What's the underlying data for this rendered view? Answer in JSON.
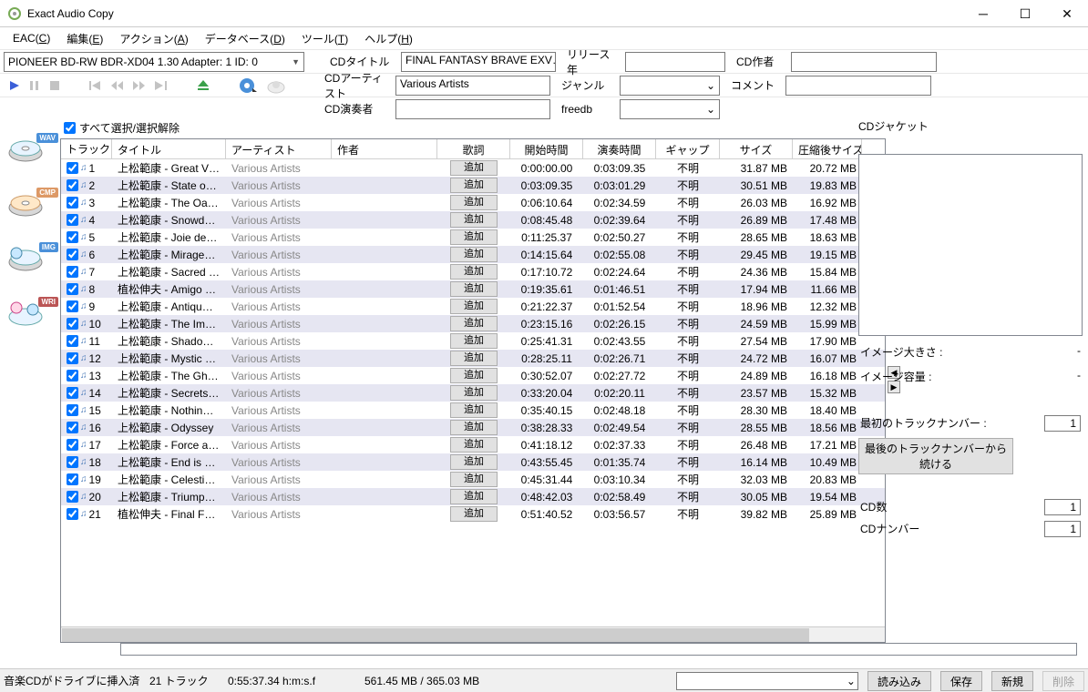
{
  "window": {
    "title": "Exact Audio Copy"
  },
  "menu": [
    "EAC(C)",
    "編集(E)",
    "アクション(A)",
    "データベース(D)",
    "ツール(T)",
    "ヘルプ(H)"
  ],
  "drive": "PIONEER BD-RW   BDR-XD04 1.30   Adapter: 1  ID: 0",
  "fields": {
    "cd_title_lbl": "CDタイトル",
    "cd_title": "FINAL FANTASY BRAVE EXV…",
    "cd_artist_lbl": "CDアーティスト",
    "cd_artist": "Various Artists",
    "cd_perf_lbl": "CD演奏者",
    "cd_perf": "",
    "release_lbl": "リリース年",
    "release": "",
    "genre_lbl": "ジャンル",
    "genre": "",
    "freedb_lbl": "freedb",
    "freedb": "",
    "cd_author_lbl": "CD作者",
    "cd_author": "",
    "comment_lbl": "コメント",
    "comment": ""
  },
  "selall": "すべて選択/選択解除",
  "cols": {
    "track": "トラック",
    "title": "タイトル",
    "artist": "アーティスト",
    "comp": "作者",
    "lyr": "歌詞",
    "start": "開始時間",
    "play": "演奏時間",
    "gap": "ギャップ",
    "size": "サイズ",
    "csize": "圧縮後サイズ"
  },
  "addlabel": "追加",
  "gap_unknown": "不明",
  "tracks": [
    {
      "n": 1,
      "title": "上松範康 - Great V…",
      "artist": "Various Artists",
      "start": "0:00:00.00",
      "play": "0:03:09.35",
      "size": "31.87 MB",
      "csize": "20.72 MB"
    },
    {
      "n": 2,
      "title": "上松範康 - State o…",
      "artist": "Various Artists",
      "start": "0:03:09.35",
      "play": "0:03:01.29",
      "size": "30.51 MB",
      "csize": "19.83 MB"
    },
    {
      "n": 3,
      "title": "上松範康 - The Oa…",
      "artist": "Various Artists",
      "start": "0:06:10.64",
      "play": "0:02:34.59",
      "size": "26.03 MB",
      "csize": "16.92 MB"
    },
    {
      "n": 4,
      "title": "上松範康 - Snowd…",
      "artist": "Various Artists",
      "start": "0:08:45.48",
      "play": "0:02:39.64",
      "size": "26.89 MB",
      "csize": "17.48 MB"
    },
    {
      "n": 5,
      "title": "上松範康 - Joie de…",
      "artist": "Various Artists",
      "start": "0:11:25.37",
      "play": "0:02:50.27",
      "size": "28.65 MB",
      "csize": "18.63 MB"
    },
    {
      "n": 6,
      "title": "上松範康 - Mirage…",
      "artist": "Various Artists",
      "start": "0:14:15.64",
      "play": "0:02:55.08",
      "size": "29.45 MB",
      "csize": "19.15 MB"
    },
    {
      "n": 7,
      "title": "上松範康 - Sacred …",
      "artist": "Various Artists",
      "start": "0:17:10.72",
      "play": "0:02:24.64",
      "size": "24.36 MB",
      "csize": "15.84 MB"
    },
    {
      "n": 8,
      "title": "植松伸夫 - Amigo …",
      "artist": "Various Artists",
      "start": "0:19:35.61",
      "play": "0:01:46.51",
      "size": "17.94 MB",
      "csize": "11.66 MB"
    },
    {
      "n": 9,
      "title": "上松範康 - Antiqu…",
      "artist": "Various Artists",
      "start": "0:21:22.37",
      "play": "0:01:52.54",
      "size": "18.96 MB",
      "csize": "12.32 MB"
    },
    {
      "n": 10,
      "title": "上松範康 - The Im…",
      "artist": "Various Artists",
      "start": "0:23:15.16",
      "play": "0:02:26.15",
      "size": "24.59 MB",
      "csize": "15.99 MB"
    },
    {
      "n": 11,
      "title": "上松範康 - Shado…",
      "artist": "Various Artists",
      "start": "0:25:41.31",
      "play": "0:02:43.55",
      "size": "27.54 MB",
      "csize": "17.90 MB"
    },
    {
      "n": 12,
      "title": "上松範康 - Mystic …",
      "artist": "Various Artists",
      "start": "0:28:25.11",
      "play": "0:02:26.71",
      "size": "24.72 MB",
      "csize": "16.07 MB"
    },
    {
      "n": 13,
      "title": "上松範康 - The Gh…",
      "artist": "Various Artists",
      "start": "0:30:52.07",
      "play": "0:02:27.72",
      "size": "24.89 MB",
      "csize": "16.18 MB"
    },
    {
      "n": 14,
      "title": "上松範康 - Secrets…",
      "artist": "Various Artists",
      "start": "0:33:20.04",
      "play": "0:02:20.11",
      "size": "23.57 MB",
      "csize": "15.32 MB"
    },
    {
      "n": 15,
      "title": "上松範康 - Nothin…",
      "artist": "Various Artists",
      "start": "0:35:40.15",
      "play": "0:02:48.18",
      "size": "28.30 MB",
      "csize": "18.40 MB"
    },
    {
      "n": 16,
      "title": "上松範康 - Odyssey",
      "artist": "Various Artists",
      "start": "0:38:28.33",
      "play": "0:02:49.54",
      "size": "28.55 MB",
      "csize": "18.56 MB"
    },
    {
      "n": 17,
      "title": "上松範康 - Force a…",
      "artist": "Various Artists",
      "start": "0:41:18.12",
      "play": "0:02:37.33",
      "size": "26.48 MB",
      "csize": "17.21 MB"
    },
    {
      "n": 18,
      "title": "上松範康 - End is …",
      "artist": "Various Artists",
      "start": "0:43:55.45",
      "play": "0:01:35.74",
      "size": "16.14 MB",
      "csize": "10.49 MB"
    },
    {
      "n": 19,
      "title": "上松範康 - Celesti…",
      "artist": "Various Artists",
      "start": "0:45:31.44",
      "play": "0:03:10.34",
      "size": "32.03 MB",
      "csize": "20.83 MB"
    },
    {
      "n": 20,
      "title": "上松範康 - Triump…",
      "artist": "Various Artists",
      "start": "0:48:42.03",
      "play": "0:02:58.49",
      "size": "30.05 MB",
      "csize": "19.54 MB"
    },
    {
      "n": 21,
      "title": "植松伸夫 - Final F…",
      "artist": "Various Artists",
      "start": "0:51:40.52",
      "play": "0:03:56.57",
      "size": "39.82 MB",
      "csize": "25.89 MB"
    }
  ],
  "right": {
    "jacket_lbl": "CDジャケット",
    "imgsize_lbl": "イメージ大きさ :",
    "imgsize": "-",
    "imgvol_lbl": "イメージ容量 :",
    "imgvol": "-",
    "firsttrack_lbl": "最初のトラックナンバー :",
    "firsttrack": "1",
    "continue_btn": "最後のトラックナンバーから続ける",
    "cdcount_lbl": "CD数",
    "cdcount": "1",
    "cdnum_lbl": "CDナンバー",
    "cdnum": "1"
  },
  "left_badges": [
    "WAV",
    "CMP",
    "IMG",
    "WRI"
  ],
  "status": {
    "drive": "音楽CDがドライブに挿入済",
    "tracks": "21 トラック",
    "time": "0:55:37.34 h:m:s.f",
    "size": "561.45 MB / 365.03 MB",
    "load": "読み込み",
    "save": "保存",
    "new": "新規",
    "del": "削除"
  }
}
